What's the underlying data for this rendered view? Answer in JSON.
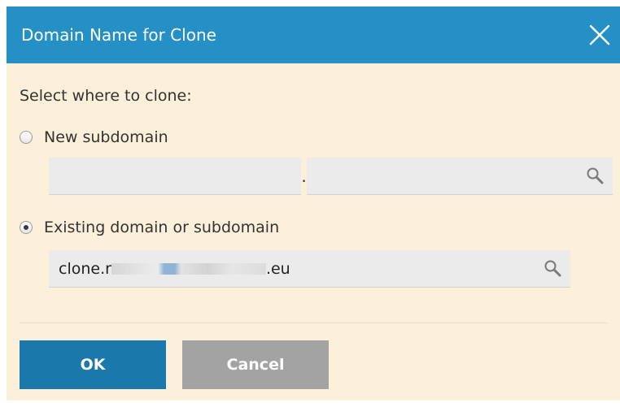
{
  "dialog": {
    "title": "Domain Name for Clone",
    "prompt": "Select where to clone:",
    "options": [
      {
        "label": "New subdomain",
        "checked": false
      },
      {
        "label": "Existing domain or subdomain",
        "checked": true
      }
    ],
    "new_subdomain": {
      "name_value": "",
      "separator": ".",
      "parent_value": ""
    },
    "existing_domain": {
      "value_prefix": "clone.r",
      "value_suffix": ".eu"
    },
    "buttons": {
      "ok_label": "OK",
      "cancel_label": "Cancel"
    }
  },
  "colors": {
    "titlebar": "#2490c6",
    "body": "#fdf0da",
    "ok": "#1a78aa",
    "cancel": "#a3a3a3"
  },
  "icons": {
    "close": "close-icon",
    "search": "search-icon"
  }
}
